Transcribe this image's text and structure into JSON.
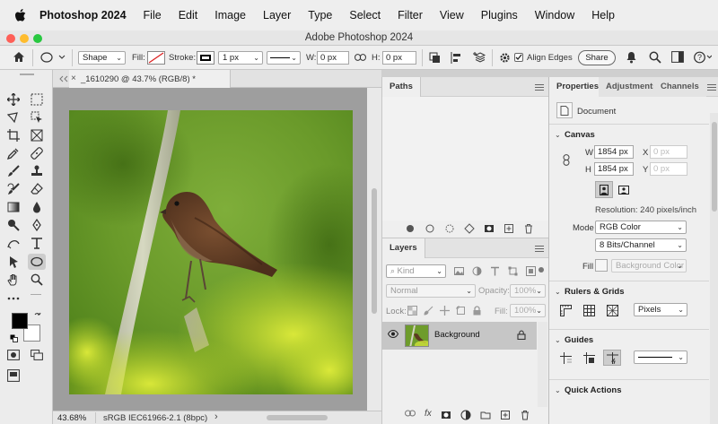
{
  "menubar": {
    "items": [
      "Photoshop 2024",
      "File",
      "Edit",
      "Image",
      "Layer",
      "Type",
      "Select",
      "Filter",
      "View",
      "Plugins",
      "Window",
      "Help"
    ]
  },
  "window": {
    "title": "Adobe Photoshop 2024"
  },
  "options": {
    "shape_mode": "Shape",
    "fill_label": "Fill:",
    "stroke_label": "Stroke:",
    "stroke_width": "1 px",
    "w_label": "W:",
    "w_value": "0 px",
    "h_label": "H:",
    "h_value": "0 px",
    "align_edges_label": "Align Edges",
    "align_edges_checked": true,
    "share_label": "Share"
  },
  "document": {
    "tab_title": "_1610290 @ 43.7% (RGB/8) *",
    "zoom": "43.68%",
    "color_profile": "sRGB IEC61966-2.1 (8bpc)"
  },
  "paths_panel": {
    "tab": "Paths"
  },
  "layers_panel": {
    "tab": "Layers",
    "filter_kind": "Kind",
    "blend_mode": "Normal",
    "opacity_label": "Opacity:",
    "opacity_value": "100%",
    "lock_label": "Lock:",
    "fill_label": "Fill:",
    "fill_value": "100%",
    "layers": [
      {
        "name": "Background",
        "visible": true,
        "locked": true
      }
    ]
  },
  "properties_panel": {
    "tabs": [
      "Properties",
      "Adjustments",
      "Channels"
    ],
    "doc_label": "Document",
    "canvas": {
      "title": "Canvas",
      "w_label": "W",
      "w_value": "1854 px",
      "h_label": "H",
      "h_value": "1854 px",
      "x_label": "X",
      "x_placeholder": "0 px",
      "y_label": "Y",
      "y_placeholder": "0 px",
      "resolution": "Resolution: 240 pixels/inch",
      "mode_label": "Mode",
      "mode_value": "RGB Color",
      "bits_value": "8 Bits/Channel",
      "fill_label": "Fill",
      "fill_value": "Background Color"
    },
    "rulers": {
      "title": "Rulers & Grids",
      "units": "Pixels"
    },
    "guides": {
      "title": "Guides"
    },
    "quick_actions": {
      "title": "Quick Actions"
    }
  },
  "colors": {
    "accent": "#1473e6",
    "foreground": "#000000",
    "background": "#ffffff"
  }
}
